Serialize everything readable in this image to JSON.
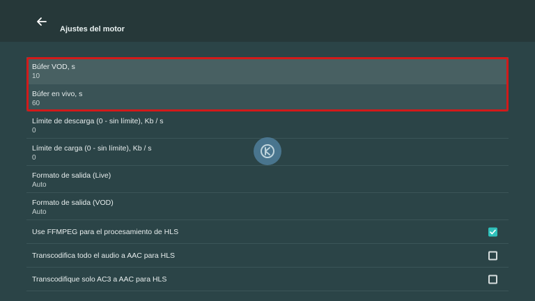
{
  "header": {
    "title": "Ajustes del motor",
    "back_icon": "arrow-left-icon"
  },
  "settings": [
    {
      "label": "Búfer VOD, s",
      "value": "10"
    },
    {
      "label": "Búfer en vivo, s",
      "value": "60"
    },
    {
      "label": "Límite de descarga (0 - sin límite), Kb / s",
      "value": "0"
    },
    {
      "label": "Límite de carga (0 - sin límite), Kb / s",
      "value": "0"
    },
    {
      "label": "Formato de salida (Live)",
      "value": "Auto"
    },
    {
      "label": "Formato de salida (VOD)",
      "value": "Auto"
    }
  ],
  "toggles": [
    {
      "label": "Use FFMPEG para el procesamiento de HLS",
      "checked": true
    },
    {
      "label": "Transcodifica todo el audio a AAC para HLS",
      "checked": false
    },
    {
      "label": "Transcodifique solo AC3 a AAC para HLS",
      "checked": false
    }
  ],
  "colors": {
    "accent": "#2fc0ba",
    "highlight_border": "#d21a1a",
    "background": "#2b4447",
    "topbar": "#263839"
  }
}
